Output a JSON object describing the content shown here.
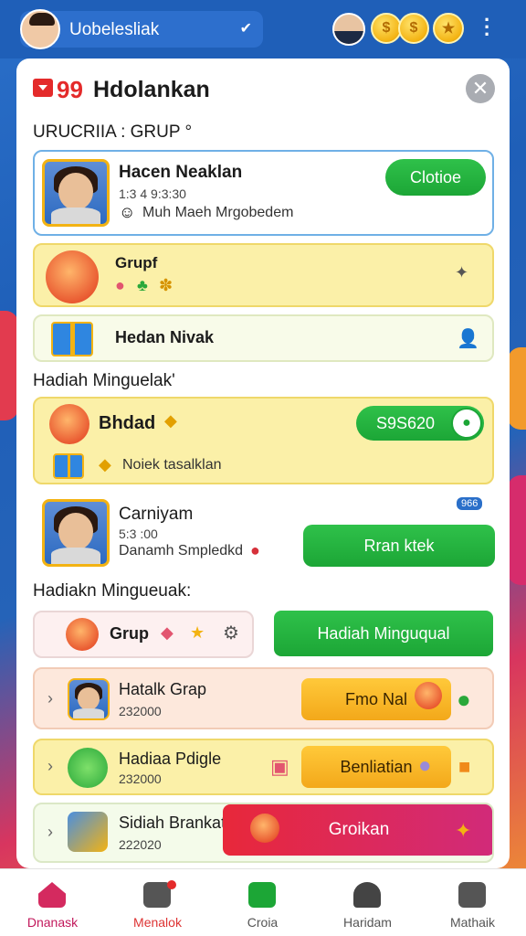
{
  "header": {
    "username": "Uobelesliak",
    "pill_icon": "✔",
    "coin_1": "$",
    "coin_2": "$",
    "coin_3": "★"
  },
  "card": {
    "brand_number": "99",
    "title": "Hdolankan",
    "close_glyph": "✕"
  },
  "section_1": {
    "label": "URUCRIIA : GRUP °",
    "featured": {
      "name": "Hacen Neaklan",
      "time": "1:3 4 9:3:30",
      "desc": "Muh Maeh Mrgobedem",
      "button": "Clotioe"
    },
    "grup_row": {
      "name": "Grupf"
    },
    "hadiah_row": {
      "name": "Hedan Nivak"
    }
  },
  "section_2": {
    "label": "Hadiah Minguelak'",
    "bhdad_row": {
      "name": "Bhdad",
      "pill": "S9S620",
      "desc": "Noiek tasalklan"
    },
    "person_row": {
      "name": "Carniyam",
      "time": "5:3 :00",
      "desc": "Danamh Smpledkd",
      "badge": "966",
      "button": "Rran ktek"
    }
  },
  "section_3": {
    "label": "Hadiakn Mingueuak:",
    "grup_name": "Grup",
    "big_button": "Hadiah Minguqual",
    "list": [
      {
        "name": "Hatalk Grap",
        "value": "232000",
        "action": "Fmo Nal"
      },
      {
        "name": "Hadiaa Pdigle",
        "value": "232000",
        "action": "Benliatian"
      },
      {
        "name": "Sidiah Brankat",
        "value": "222020",
        "action": "Groikan"
      }
    ]
  },
  "bottom_nav": [
    {
      "label": "Dnanask"
    },
    {
      "label": "Menalok"
    },
    {
      "label": "Croia"
    },
    {
      "label": "Haridam"
    },
    {
      "label": "Mathaik"
    }
  ],
  "colors": {
    "accent_green": "#1ca636",
    "accent_yellow": "#f3b313",
    "accent_red": "#e42a2a",
    "header_blue": "#1f5fb8"
  }
}
